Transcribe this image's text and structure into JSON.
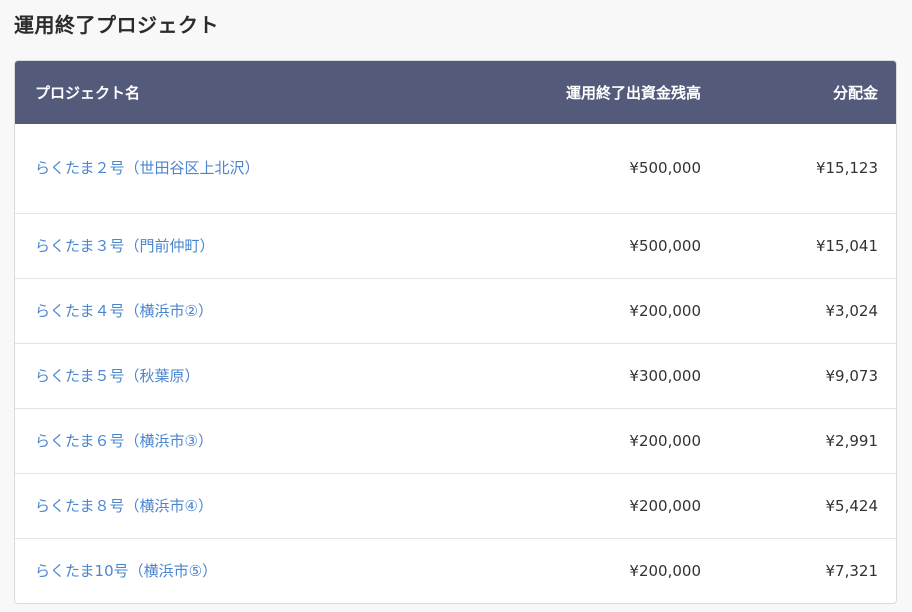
{
  "section": {
    "title": "運用終了プロジェクト"
  },
  "table": {
    "headers": {
      "name": "プロジェクト名",
      "amount": "運用終了出資金残高",
      "distribution": "分配金"
    },
    "rows": [
      {
        "name": "らくたま２号（世田谷区上北沢）",
        "amount": "¥500,000",
        "distribution": "¥15,123"
      },
      {
        "name": "らくたま３号（門前仲町）",
        "amount": "¥500,000",
        "distribution": "¥15,041"
      },
      {
        "name": "らくたま４号（横浜市②）",
        "amount": "¥200,000",
        "distribution": "¥3,024"
      },
      {
        "name": "らくたま５号（秋葉原）",
        "amount": "¥300,000",
        "distribution": "¥9,073"
      },
      {
        "name": "らくたま６号（横浜市③）",
        "amount": "¥200,000",
        "distribution": "¥2,991"
      },
      {
        "name": "らくたま８号（横浜市④）",
        "amount": "¥200,000",
        "distribution": "¥5,424"
      },
      {
        "name": "らくたま10号（横浜市⑤）",
        "amount": "¥200,000",
        "distribution": "¥7,321"
      }
    ]
  },
  "colors": {
    "header_bg": "#545a7a",
    "link": "#4a86d0",
    "border": "#e2e4e8"
  }
}
